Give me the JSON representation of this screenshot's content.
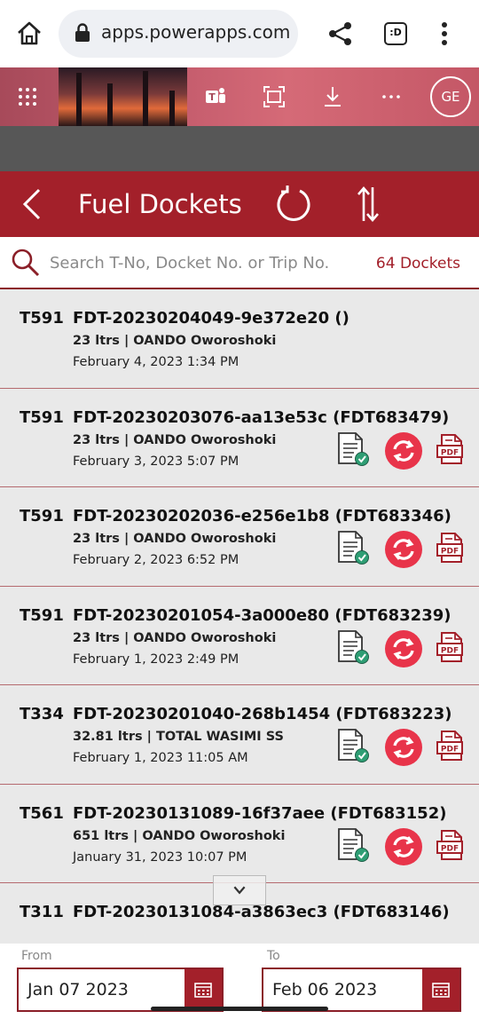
{
  "browser": {
    "url": "apps.powerapps.com",
    "tabs_label": ":D"
  },
  "header": {
    "avatar_initials": "GE"
  },
  "app": {
    "title": "Fuel Dockets",
    "search_placeholder": "Search T-No, Docket No. or Trip No.",
    "count_label": "64 Dockets"
  },
  "dockets": [
    {
      "tno": "T591",
      "docket": "FDT-20230204049-9e372e20 ()",
      "detail": "23 ltrs | OANDO Oworoshoki",
      "date": "February 4, 2023 1:34 PM",
      "actions": false
    },
    {
      "tno": "T591",
      "docket": "FDT-20230203076-aa13e53c (FDT683479)",
      "detail": "23 ltrs | OANDO Oworoshoki",
      "date": "February 3, 2023 5:07 PM",
      "actions": true
    },
    {
      "tno": "T591",
      "docket": "FDT-20230202036-e256e1b8 (FDT683346)",
      "detail": "23 ltrs | OANDO Oworoshoki",
      "date": "February 2, 2023 6:52 PM",
      "actions": true
    },
    {
      "tno": "T591",
      "docket": "FDT-20230201054-3a000e80 (FDT683239)",
      "detail": "23 ltrs | OANDO Oworoshoki",
      "date": "February 1, 2023 2:49 PM",
      "actions": true
    },
    {
      "tno": "T334",
      "docket": "FDT-20230201040-268b1454 (FDT683223)",
      "detail": "32.81 ltrs | TOTAL WASIMI SS",
      "date": "February 1, 2023 11:05 AM",
      "actions": true
    },
    {
      "tno": "T561",
      "docket": "FDT-20230131089-16f37aee (FDT683152)",
      "detail": "651 ltrs | OANDO Oworoshoki",
      "date": "January 31, 2023 10:07 PM",
      "actions": true
    },
    {
      "tno": "T311",
      "docket": "FDT-20230131084-a3863ec3 (FDT683146)",
      "detail": "",
      "date": "",
      "actions": false
    }
  ],
  "filter": {
    "from_label": "From",
    "from_value": "Jan 07 2023",
    "to_label": "To",
    "to_value": "Feb 06 2023"
  },
  "colors": {
    "brand": "#a3202a",
    "sync": "#e8344a"
  },
  "icons": [
    "home-icon",
    "lock-icon",
    "share-icon",
    "more-icon",
    "waffle-icon",
    "teams-icon",
    "fullscreen-icon",
    "download-icon",
    "ellipsis-icon",
    "back-icon",
    "refresh-icon",
    "sort-icon",
    "search-icon",
    "doc-check-icon",
    "sync-icon",
    "pdf-icon",
    "calendar-icon",
    "chevron-down-icon"
  ]
}
